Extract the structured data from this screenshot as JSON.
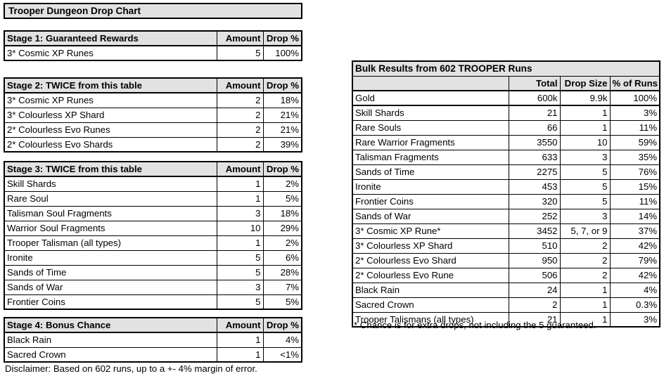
{
  "title_banner": "Trooper Dungeon Drop Chart",
  "left_tables": [
    {
      "id": "stage1",
      "title": "Stage 1: Guaranteed Rewards",
      "columns": [
        "Amount",
        "Drop %"
      ],
      "rows": [
        {
          "name": "3* Cosmic XP Runes",
          "amount": "5",
          "drop": "100%"
        }
      ]
    },
    {
      "id": "stage2",
      "title": "Stage 2: TWICE from this table",
      "columns": [
        "Amount",
        "Drop %"
      ],
      "rows": [
        {
          "name": "3* Cosmic XP Runes",
          "amount": "2",
          "drop": "18%"
        },
        {
          "name": "3* Colourless XP Shard",
          "amount": "2",
          "drop": "21%"
        },
        {
          "name": "2* Colourless Evo Runes",
          "amount": "2",
          "drop": "21%"
        },
        {
          "name": "2* Colourless Evo Shards",
          "amount": "2",
          "drop": "39%"
        }
      ]
    },
    {
      "id": "stage3",
      "title": "Stage 3: TWICE from this table",
      "columns": [
        "Amount",
        "Drop %"
      ],
      "rows": [
        {
          "name": "Skill Shards",
          "amount": "1",
          "drop": "2%"
        },
        {
          "name": "Rare Soul",
          "amount": "1",
          "drop": "5%"
        },
        {
          "name": "Talisman Soul Fragments",
          "amount": "3",
          "drop": "18%"
        },
        {
          "name": "Warrior Soul Fragments",
          "amount": "10",
          "drop": "29%"
        },
        {
          "name": "Trooper Talisman (all types)",
          "amount": "1",
          "drop": "2%"
        },
        {
          "name": "Ironite",
          "amount": "5",
          "drop": "6%"
        },
        {
          "name": "Sands of Time",
          "amount": "5",
          "drop": "28%"
        },
        {
          "name": "Sands of War",
          "amount": "3",
          "drop": "7%"
        },
        {
          "name": "Frontier Coins",
          "amount": "5",
          "drop": "5%"
        }
      ]
    },
    {
      "id": "stage4",
      "title": "Stage 4: Bonus Chance",
      "columns": [
        "Amount",
        "Drop %"
      ],
      "rows": [
        {
          "name": "Black Rain",
          "amount": "1",
          "drop": "4%"
        },
        {
          "name": "Sacred Crown",
          "amount": "1",
          "drop": "<1%"
        }
      ]
    }
  ],
  "disclaimer": "Disclaimer: Based on 602 runs, up to a +- 4% margin of error.",
  "bulk": {
    "title": "Bulk Results from 602 TROOPER Runs",
    "columns": [
      "",
      "Total",
      "Drop Size",
      "% of Runs"
    ],
    "rows": [
      {
        "name": "Gold",
        "total": "600k",
        "size": "9.9k",
        "pct": "100%"
      },
      {
        "name": "Skill Shards",
        "total": "21",
        "size": "1",
        "pct": "3%"
      },
      {
        "name": "Rare Souls",
        "total": "66",
        "size": "1",
        "pct": "11%"
      },
      {
        "name": "Rare Warrior Fragments",
        "total": "3550",
        "size": "10",
        "pct": "59%"
      },
      {
        "name": "Talisman Fragments",
        "total": "633",
        "size": "3",
        "pct": "35%"
      },
      {
        "name": "Sands of Time",
        "total": "2275",
        "size": "5",
        "pct": "76%"
      },
      {
        "name": "Ironite",
        "total": "453",
        "size": "5",
        "pct": "15%"
      },
      {
        "name": "Frontier Coins",
        "total": "320",
        "size": "5",
        "pct": "11%"
      },
      {
        "name": "Sands of War",
        "total": "252",
        "size": "3",
        "pct": "14%"
      },
      {
        "name": "3* Cosmic XP Rune*",
        "total": "3452",
        "size": "5, 7, or 9",
        "pct": "37%"
      },
      {
        "name": "3* Colourless XP Shard",
        "total": "510",
        "size": "2",
        "pct": "42%"
      },
      {
        "name": "2* Colourless Evo Shard",
        "total": "950",
        "size": "2",
        "pct": "79%"
      },
      {
        "name": "2* Colourless Evo Rune",
        "total": "506",
        "size": "2",
        "pct": "42%"
      },
      {
        "name": "Black Rain",
        "total": "24",
        "size": "1",
        "pct": "4%"
      },
      {
        "name": "Sacred Crown",
        "total": "2",
        "size": "1",
        "pct": "0.3%"
      },
      {
        "name": "Trooper Talismans (all types)",
        "total": "21",
        "size": "1",
        "pct": "3%"
      }
    ],
    "footnote": "* Chance is for extra drops, not including the 5 guaranteed."
  },
  "colors": {
    "header_fill": "#e2e2e2",
    "grid": "#000000",
    "background": "#ffffff"
  }
}
